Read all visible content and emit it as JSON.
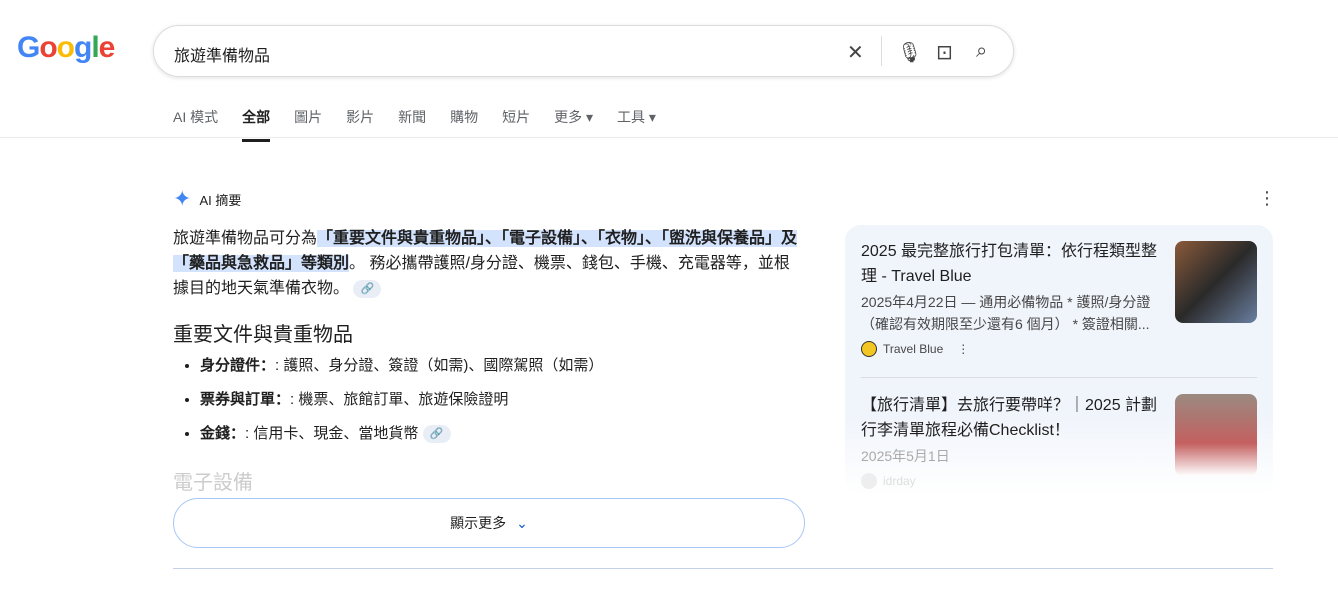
{
  "search": {
    "query": "旅遊準備物品"
  },
  "tabs": [
    "AI 模式",
    "全部",
    "圖片",
    "影片",
    "新聞",
    "購物",
    "短片",
    "更多 ▾",
    "工具 ▾"
  ],
  "ai": {
    "label": "AI 摘要",
    "intro_pre": "旅遊準備物品可分為",
    "intro_hl1": "「重要文件與貴重物品」、「電子設備」、「衣物」、「盥洗與保養品」及",
    "intro_hl2": "「藥品與急救品」等類別",
    "intro_post": "。 務必攜帶護照/身分證、機票、錢包、手機、充電器等，並根據目的地天氣準備衣物。",
    "section1": "重要文件與貴重物品",
    "items": [
      {
        "k": "身分證件：",
        "v": ": 護照、身分證、簽證（如需)、國際駕照（如需）"
      },
      {
        "k": "票券與訂單：",
        "v": ": 機票、旅館訂單、旅遊保險證明"
      },
      {
        "k": "金錢：",
        "v": ": 信用卡、現金、當地貨幣"
      }
    ],
    "section2": "電子設備",
    "show_more": "顯示更多"
  },
  "sources": [
    {
      "title": "2025 最完整旅行打包清單：依行程類型整理 - Travel Blue",
      "snippet": "2025年4月22日 — 通用必備物品 * 護照/身分證（確認有效期限至少還有6 個月） * 簽證相關...",
      "site": "Travel Blue"
    },
    {
      "title": "【旅行清單】去旅行要帶咩？｜2025 計劃行李清單旅程必備Checklist！",
      "snippet": "2025年5月1日",
      "site": "idrday"
    }
  ]
}
